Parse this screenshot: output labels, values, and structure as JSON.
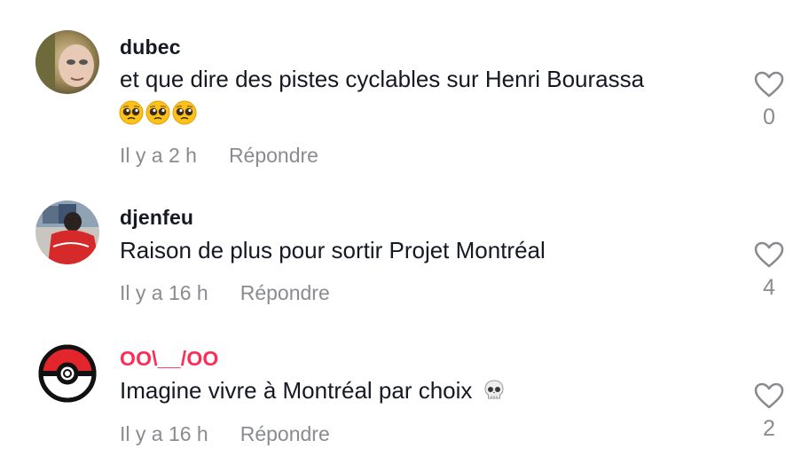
{
  "comments": [
    {
      "username": "dubec",
      "text": "et que dire des pistes cyclables sur Henri Bourassa",
      "emojis": [
        "pleading-face",
        "pleading-face",
        "pleading-face"
      ],
      "time": "Il y a 2 h",
      "reply_label": "Répondre",
      "likes": "0"
    },
    {
      "username": "djenfeu",
      "text": "Raison de plus pour sortir Projet Montréal",
      "time": "Il y a 16 h",
      "reply_label": "Répondre",
      "likes": "4"
    },
    {
      "username": "OO\\__/OO",
      "text": "Imagine vivre à Montréal par choix",
      "trailing_emoji": "skull",
      "time": "Il y a 16 h",
      "reply_label": "Répondre",
      "likes": "2"
    }
  ],
  "icons": {
    "like": "heart-outline-icon"
  },
  "colors": {
    "text": "#161823",
    "muted": "#8a8b91",
    "username_accent": "#fe2c55"
  }
}
